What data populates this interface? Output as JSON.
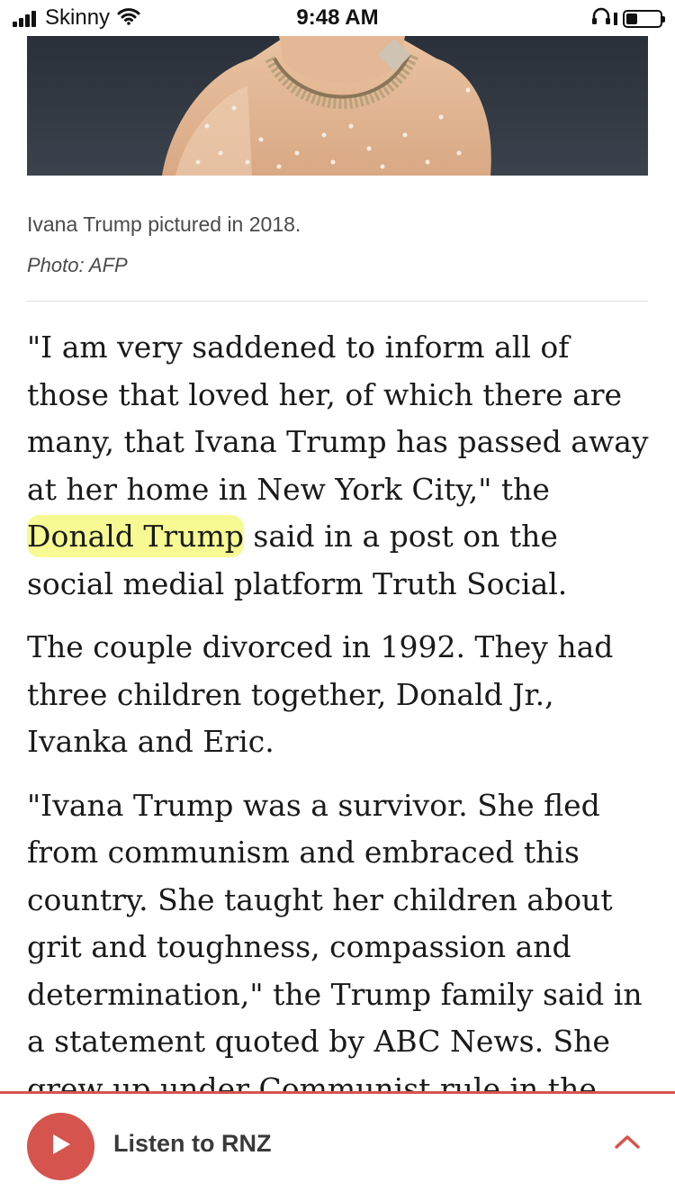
{
  "status_bar": {
    "carrier": "Skinny",
    "time": "9:48 AM"
  },
  "photo": {
    "caption": "Ivana Trump pictured in 2018.",
    "credit": "Photo: AFP"
  },
  "article": {
    "p1": {
      "a": "\"I am very saddened to inform all of those that loved her, of which there are many, that Ivana Trump has passed away at her home in New York City,\" the",
      "b": "Donald Trump",
      "c": " said in a post on the social medial platform Truth Social."
    },
    "p2": "The couple divorced in 1992. They had three children together, Donald Jr., Ivanka and Eric.",
    "p3": "\"Ivana Trump was a survivor. She fled from communism and embraced this country. She taught her children about grit and toughness, compassion and determination,\" the Trump family said in a statement quoted by ABC News. She grew up under Communist rule in the"
  },
  "player": {
    "label": "Listen to RNZ",
    "accent_color": "#d6544e"
  },
  "icons": [
    "wifi-icon",
    "headphones-icon",
    "battery-icon",
    "play-icon",
    "chevron-up-icon"
  ]
}
